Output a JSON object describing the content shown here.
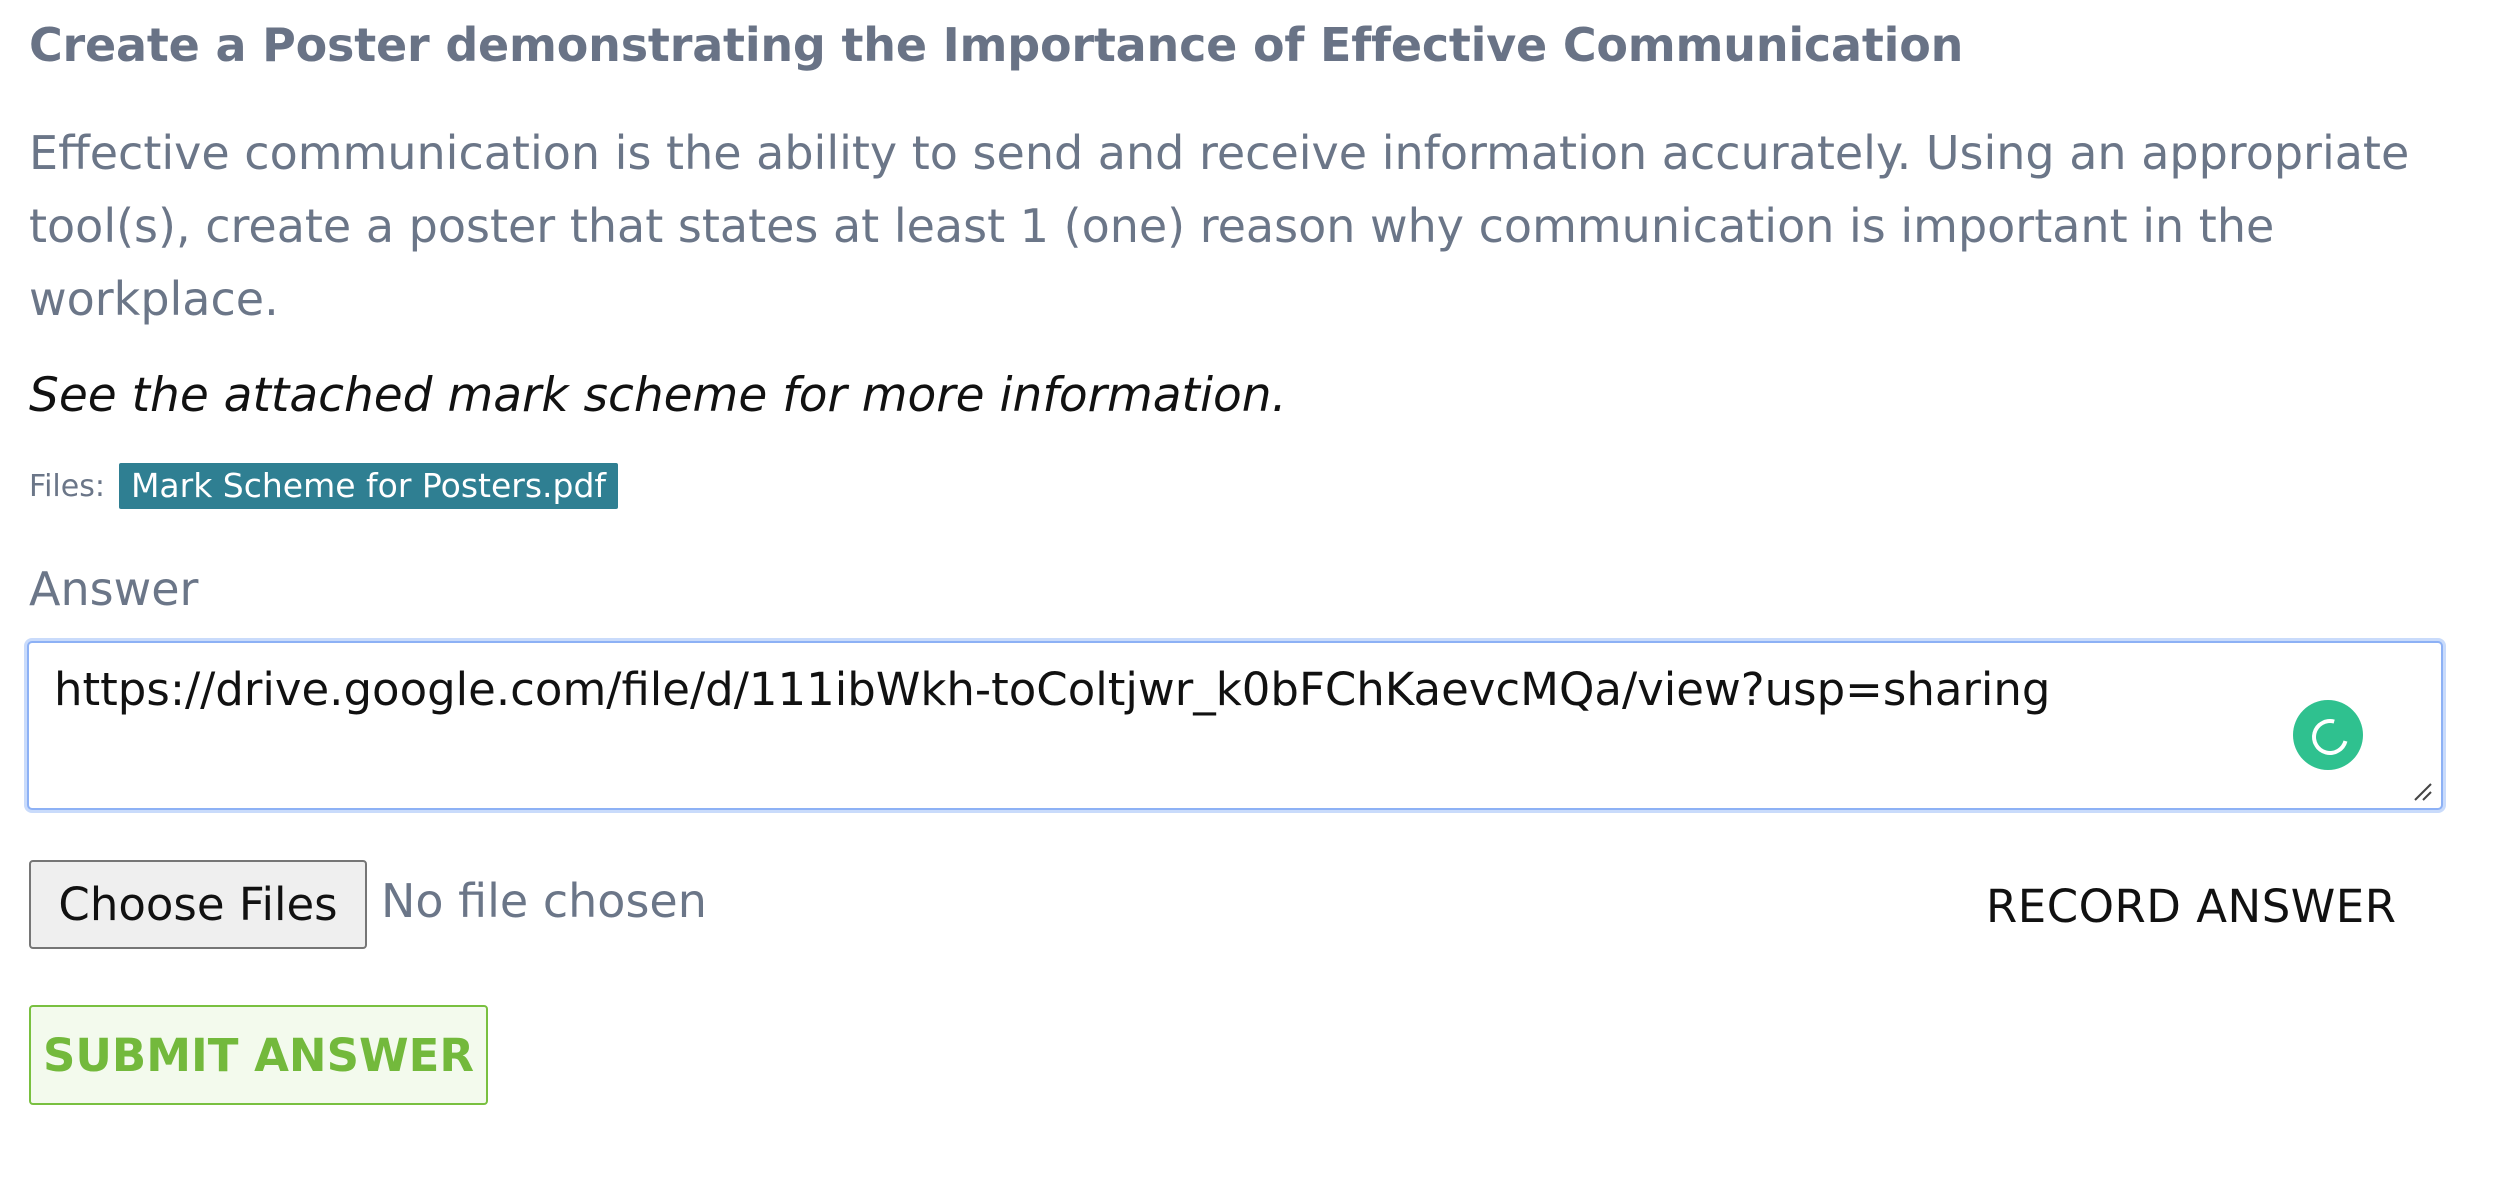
{
  "task": {
    "title": "Create a Poster demonstrating the Importance of  Effective Communication",
    "description": "Effective communication is the ability to send and receive information accurately. Using an appropriate tool(s), create a poster that states at least 1 (one) reason why communication is important in the workplace.",
    "hint": "See the attached mark scheme for more information."
  },
  "files": {
    "label": "Files:",
    "items": [
      {
        "name": "Mark Scheme for Posters.pdf"
      }
    ]
  },
  "answer": {
    "label": "Answer",
    "value": "https://drive.google.com/file/d/111ibWkh-toColtjwr_k0bFChKaevcMQa/view?usp=sharing"
  },
  "upload": {
    "button_label": "Choose Files",
    "status": "No file chosen"
  },
  "actions": {
    "record_label": "RECORD ANSWER",
    "submit_label": "SUBMIT ANSWER"
  },
  "colors": {
    "file_chip": "#2f7f92",
    "submit_green": "#73b93c",
    "focus_blue": "#8db1f5",
    "grammar_badge": "#2fc18f"
  },
  "icons": {
    "grammar_badge": "grammar-check-icon",
    "resize_handle": "resize-handle-icon"
  }
}
